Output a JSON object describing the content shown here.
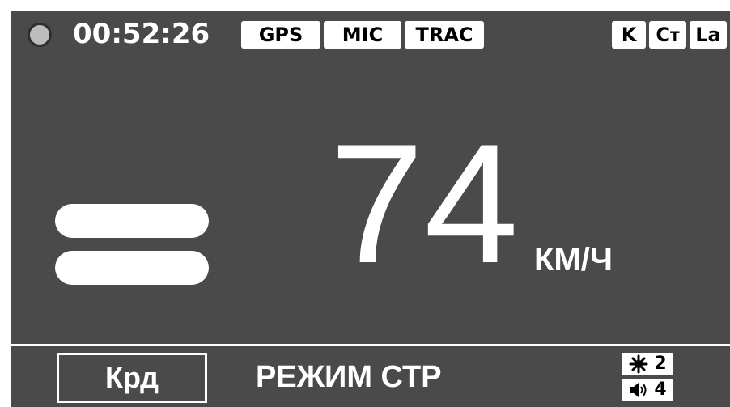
{
  "status_bar": {
    "time": "00:52:26",
    "badges": [
      "GPS",
      "MIC",
      "TRAC"
    ],
    "bands": {
      "k": "K",
      "ct_main": "C",
      "ct_sub": "T",
      "la": "La"
    }
  },
  "speed": {
    "value": "74",
    "unit": "КМ/Ч"
  },
  "bottom": {
    "region": "Крд",
    "mode": "РЕЖИМ СТР",
    "brightness_level": "2",
    "volume_level": "4"
  },
  "colors": {
    "panel": "#4a4a4a",
    "foreground": "#ffffff",
    "badge_text": "#000000"
  },
  "icons": [
    "record-indicator-icon",
    "signal-bars-icon",
    "brightness-icon",
    "volume-icon"
  ]
}
